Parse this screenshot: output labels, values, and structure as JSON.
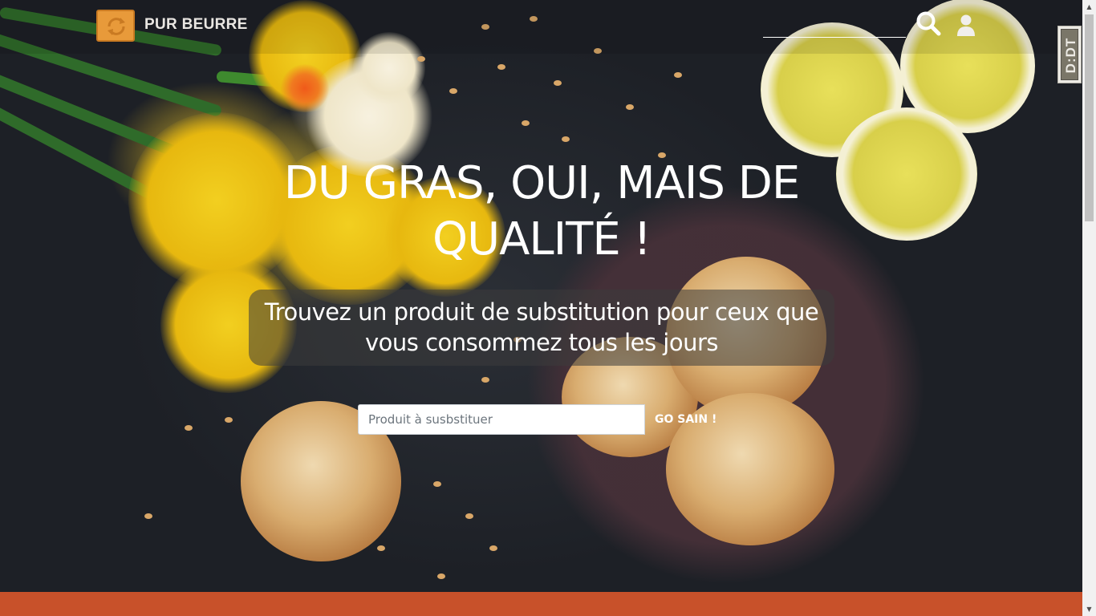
{
  "brand": {
    "name": "PUR BEURRE",
    "logo_icon": "cookie-refresh-icon"
  },
  "navbar": {
    "search_value": "",
    "search_icon": "search-icon",
    "user_icon": "user-icon"
  },
  "side_badge": {
    "text": "D:DT"
  },
  "hero": {
    "title": "DU GRAS, OUI, MAIS DE QUALITÉ !",
    "subtitle": "Trouvez un produit de substitution pour ceux que vous consommez tous les jours"
  },
  "search_form": {
    "placeholder": "Produit à susbstituer",
    "value": "",
    "submit_label": "GO SAIN !"
  },
  "colors": {
    "accent": "#c8512a",
    "logo": "#e89a3a",
    "text": "#ffffff"
  }
}
